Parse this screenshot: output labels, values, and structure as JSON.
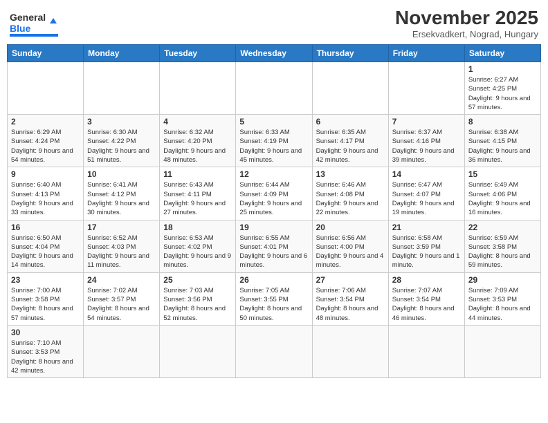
{
  "header": {
    "logo_general": "General",
    "logo_blue": "Blue",
    "month_title": "November 2025",
    "subtitle": "Ersekvadkert, Nograd, Hungary"
  },
  "weekdays": [
    "Sunday",
    "Monday",
    "Tuesday",
    "Wednesday",
    "Thursday",
    "Friday",
    "Saturday"
  ],
  "days": {
    "d1": {
      "num": "1",
      "sunrise": "6:27 AM",
      "sunset": "4:25 PM",
      "daylight": "9 hours and 57 minutes."
    },
    "d2": {
      "num": "2",
      "sunrise": "6:29 AM",
      "sunset": "4:24 PM",
      "daylight": "9 hours and 54 minutes."
    },
    "d3": {
      "num": "3",
      "sunrise": "6:30 AM",
      "sunset": "4:22 PM",
      "daylight": "9 hours and 51 minutes."
    },
    "d4": {
      "num": "4",
      "sunrise": "6:32 AM",
      "sunset": "4:20 PM",
      "daylight": "9 hours and 48 minutes."
    },
    "d5": {
      "num": "5",
      "sunrise": "6:33 AM",
      "sunset": "4:19 PM",
      "daylight": "9 hours and 45 minutes."
    },
    "d6": {
      "num": "6",
      "sunrise": "6:35 AM",
      "sunset": "4:17 PM",
      "daylight": "9 hours and 42 minutes."
    },
    "d7": {
      "num": "7",
      "sunrise": "6:37 AM",
      "sunset": "4:16 PM",
      "daylight": "9 hours and 39 minutes."
    },
    "d8": {
      "num": "8",
      "sunrise": "6:38 AM",
      "sunset": "4:15 PM",
      "daylight": "9 hours and 36 minutes."
    },
    "d9": {
      "num": "9",
      "sunrise": "6:40 AM",
      "sunset": "4:13 PM",
      "daylight": "9 hours and 33 minutes."
    },
    "d10": {
      "num": "10",
      "sunrise": "6:41 AM",
      "sunset": "4:12 PM",
      "daylight": "9 hours and 30 minutes."
    },
    "d11": {
      "num": "11",
      "sunrise": "6:43 AM",
      "sunset": "4:11 PM",
      "daylight": "9 hours and 27 minutes."
    },
    "d12": {
      "num": "12",
      "sunrise": "6:44 AM",
      "sunset": "4:09 PM",
      "daylight": "9 hours and 25 minutes."
    },
    "d13": {
      "num": "13",
      "sunrise": "6:46 AM",
      "sunset": "4:08 PM",
      "daylight": "9 hours and 22 minutes."
    },
    "d14": {
      "num": "14",
      "sunrise": "6:47 AM",
      "sunset": "4:07 PM",
      "daylight": "9 hours and 19 minutes."
    },
    "d15": {
      "num": "15",
      "sunrise": "6:49 AM",
      "sunset": "4:06 PM",
      "daylight": "9 hours and 16 minutes."
    },
    "d16": {
      "num": "16",
      "sunrise": "6:50 AM",
      "sunset": "4:04 PM",
      "daylight": "9 hours and 14 minutes."
    },
    "d17": {
      "num": "17",
      "sunrise": "6:52 AM",
      "sunset": "4:03 PM",
      "daylight": "9 hours and 11 minutes."
    },
    "d18": {
      "num": "18",
      "sunrise": "6:53 AM",
      "sunset": "4:02 PM",
      "daylight": "9 hours and 9 minutes."
    },
    "d19": {
      "num": "19",
      "sunrise": "6:55 AM",
      "sunset": "4:01 PM",
      "daylight": "9 hours and 6 minutes."
    },
    "d20": {
      "num": "20",
      "sunrise": "6:56 AM",
      "sunset": "4:00 PM",
      "daylight": "9 hours and 4 minutes."
    },
    "d21": {
      "num": "21",
      "sunrise": "6:58 AM",
      "sunset": "3:59 PM",
      "daylight": "9 hours and 1 minute."
    },
    "d22": {
      "num": "22",
      "sunrise": "6:59 AM",
      "sunset": "3:58 PM",
      "daylight": "8 hours and 59 minutes."
    },
    "d23": {
      "num": "23",
      "sunrise": "7:00 AM",
      "sunset": "3:58 PM",
      "daylight": "8 hours and 57 minutes."
    },
    "d24": {
      "num": "24",
      "sunrise": "7:02 AM",
      "sunset": "3:57 PM",
      "daylight": "8 hours and 54 minutes."
    },
    "d25": {
      "num": "25",
      "sunrise": "7:03 AM",
      "sunset": "3:56 PM",
      "daylight": "8 hours and 52 minutes."
    },
    "d26": {
      "num": "26",
      "sunrise": "7:05 AM",
      "sunset": "3:55 PM",
      "daylight": "8 hours and 50 minutes."
    },
    "d27": {
      "num": "27",
      "sunrise": "7:06 AM",
      "sunset": "3:54 PM",
      "daylight": "8 hours and 48 minutes."
    },
    "d28": {
      "num": "28",
      "sunrise": "7:07 AM",
      "sunset": "3:54 PM",
      "daylight": "8 hours and 46 minutes."
    },
    "d29": {
      "num": "29",
      "sunrise": "7:09 AM",
      "sunset": "3:53 PM",
      "daylight": "8 hours and 44 minutes."
    },
    "d30": {
      "num": "30",
      "sunrise": "7:10 AM",
      "sunset": "3:53 PM",
      "daylight": "8 hours and 42 minutes."
    }
  },
  "labels": {
    "sunrise": "Sunrise:",
    "sunset": "Sunset:",
    "daylight": "Daylight:"
  }
}
